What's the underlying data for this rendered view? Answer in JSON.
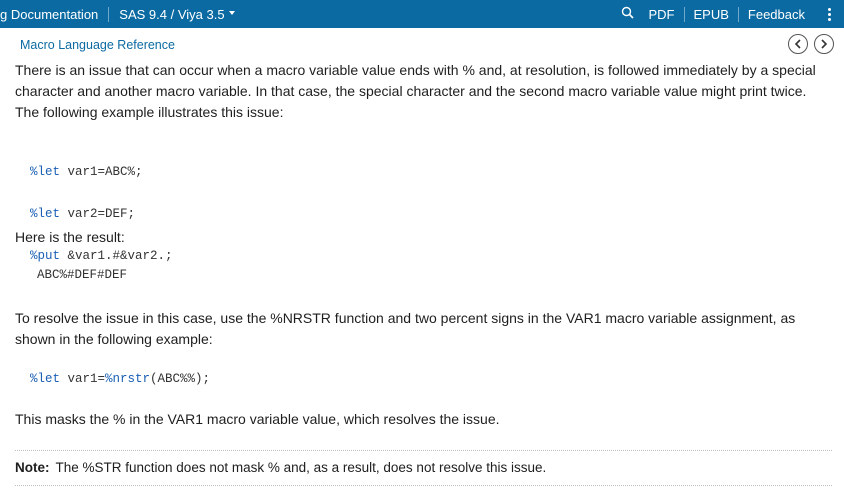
{
  "topbar": {
    "title": "g Documentation",
    "version": "SAS 9.4 / Viya 3.5",
    "links": {
      "pdf": "PDF",
      "epub": "EPUB",
      "feedback": "Feedback"
    },
    "icons": {
      "search": "search-icon",
      "menu": "kebab-menu-icon",
      "caret": "caret-down-icon"
    },
    "colors": {
      "bar_bg": "#0b6aa2",
      "text": "#ffffff"
    }
  },
  "breadcrumb": {
    "label": "Macro Language Reference"
  },
  "nav": {
    "prev_icon": "chevron-left-icon",
    "next_icon": "chevron-right-icon"
  },
  "content": {
    "p1": "There is an issue that can occur when a macro variable value ends with % and, at resolution, is followed immediately by a special character and another macro variable. In that case, the special character and the second macro variable value might print twice. The following example illustrates this issue:",
    "code1": [
      {
        "kw": "%let",
        "rest": " var1=ABC%;"
      },
      {
        "kw": "%let",
        "rest": " var2=DEF;"
      },
      {
        "kw": "%put",
        "rest": " &var1.#&var2.;"
      }
    ],
    "p2": "Here is the result:",
    "result": "ABC%#DEF#DEF",
    "p3": "To resolve the issue in this case, use the %NRSTR function and two percent signs in the VAR1 macro variable assignment, as shown in the following example:",
    "code2": {
      "kw": "%let",
      "mid": " var1=",
      "fn": "%nrstr",
      "rest": "(ABC%%);"
    },
    "p4": "This masks the % in the VAR1 macro variable value, which resolves the issue.",
    "note": {
      "label": "Note:",
      "text": "The %STR function does not mask % and, as a result, does not resolve this issue."
    }
  }
}
